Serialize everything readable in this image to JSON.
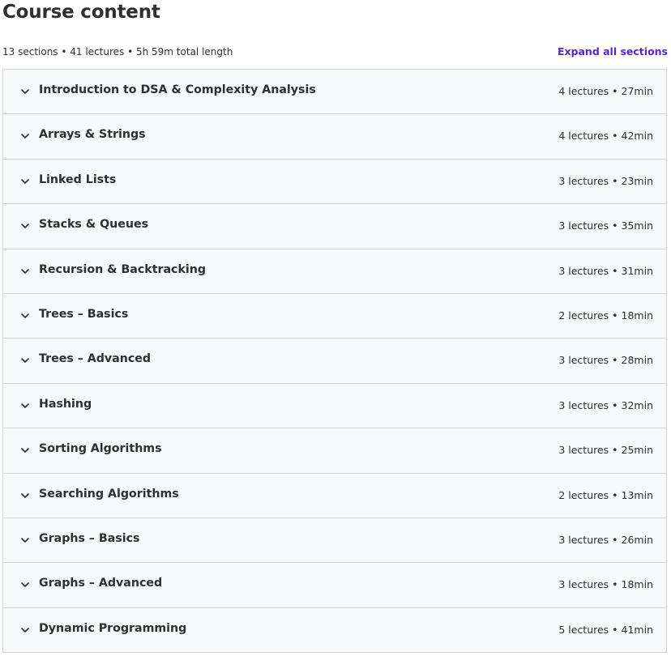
{
  "header": {
    "title": "Course content",
    "summary": "13 sections • 41 lectures • 5h 59m total length",
    "expand_label": "Expand all sections"
  },
  "icons": {
    "section_toggle": "chevron-down-icon"
  },
  "colors": {
    "accent": "#5624d0",
    "section_bg": "#f7f9fa",
    "border": "#d1d7dc",
    "text": "#2d2f31"
  },
  "sections": [
    {
      "title": "Introduction to DSA & Complexity Analysis",
      "meta": "4 lectures • 27min"
    },
    {
      "title": "Arrays & Strings",
      "meta": "4 lectures • 42min"
    },
    {
      "title": "Linked Lists",
      "meta": "3 lectures • 23min"
    },
    {
      "title": "Stacks & Queues",
      "meta": "3 lectures • 35min"
    },
    {
      "title": "Recursion & Backtracking",
      "meta": "3 lectures • 31min"
    },
    {
      "title": "Trees – Basics",
      "meta": "2 lectures • 18min"
    },
    {
      "title": "Trees – Advanced",
      "meta": "3 lectures • 28min"
    },
    {
      "title": "Hashing",
      "meta": "3 lectures • 32min"
    },
    {
      "title": "Sorting Algorithms",
      "meta": "3 lectures • 25min"
    },
    {
      "title": "Searching Algorithms",
      "meta": "2 lectures • 13min"
    },
    {
      "title": "Graphs – Basics",
      "meta": "3 lectures • 26min"
    },
    {
      "title": "Graphs – Advanced",
      "meta": "3 lectures • 18min"
    },
    {
      "title": "Dynamic Programming",
      "meta": "5 lectures • 41min"
    }
  ]
}
